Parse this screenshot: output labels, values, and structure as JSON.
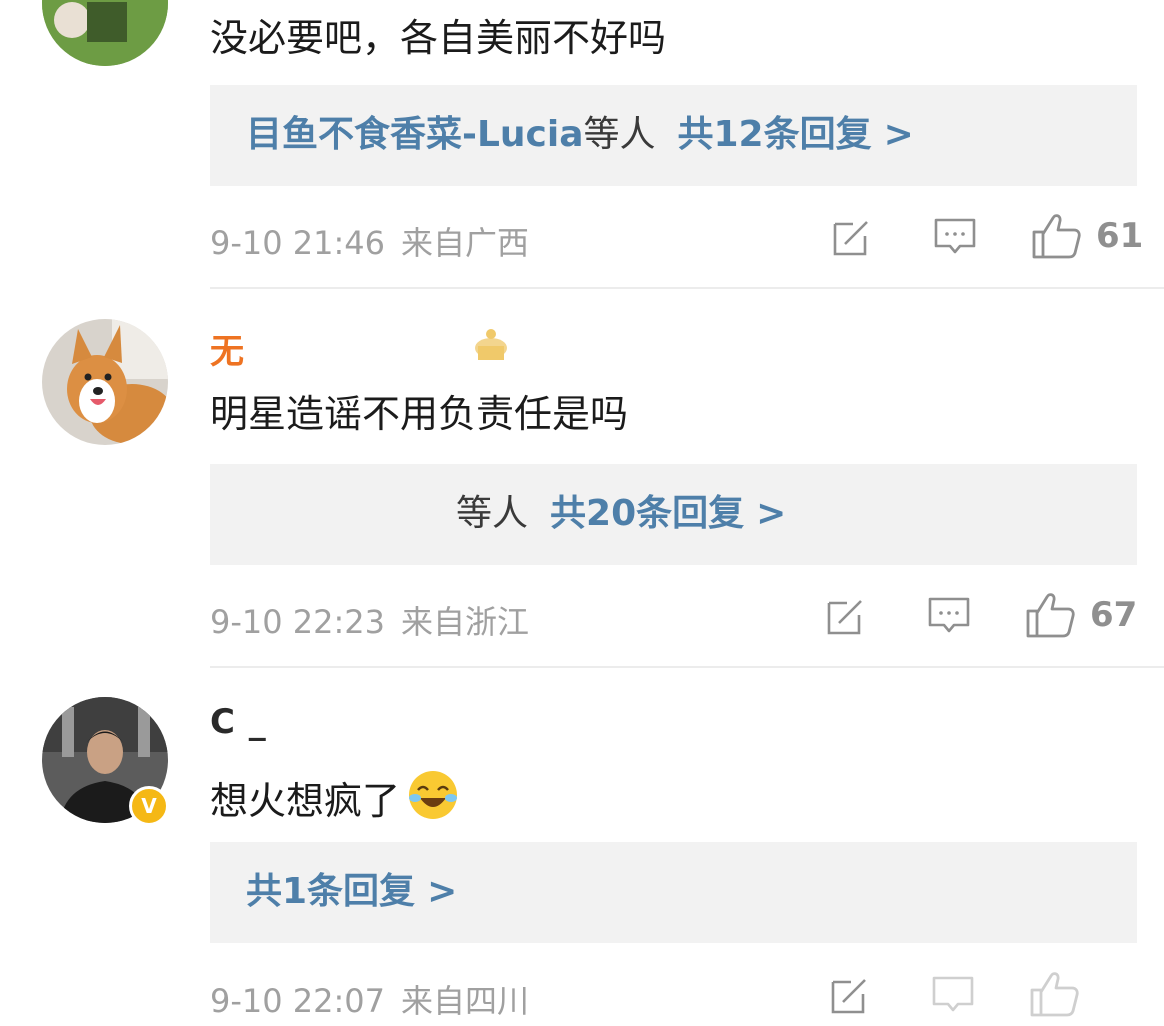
{
  "comments": [
    {
      "name": "",
      "text": "没必要吧，各自美丽不好吗",
      "reply_user": "目鱼不食香菜-Lucia",
      "reply_etc": "等人",
      "reply_count": "共12条回复",
      "reply_arrow": ">",
      "time": "9-10 21:46",
      "location": "来自广西",
      "likes": "61"
    },
    {
      "name": "无",
      "text": "明星造谣不用负责任是吗",
      "reply_user": "",
      "reply_etc": "等人",
      "reply_count": "共20条回复",
      "reply_arrow": ">",
      "time": "9-10 22:23",
      "location": "来自浙江",
      "likes": "67"
    },
    {
      "name": "C    _",
      "text": "想火想疯了",
      "reply_user": "",
      "reply_etc": "",
      "reply_count": "共1条回复",
      "reply_arrow": ">",
      "time": "9-10 22:07",
      "location": "来自四川",
      "likes": ""
    }
  ],
  "icons": {
    "edit": "edit-icon",
    "comment": "comment-icon",
    "like": "thumbs-up-icon",
    "verified": "verified-badge-icon"
  },
  "colors": {
    "link": "#4e7fa9",
    "meta": "#a0a0a0",
    "name_orange": "#ee7322",
    "reply_bg": "#f2f2f2"
  }
}
